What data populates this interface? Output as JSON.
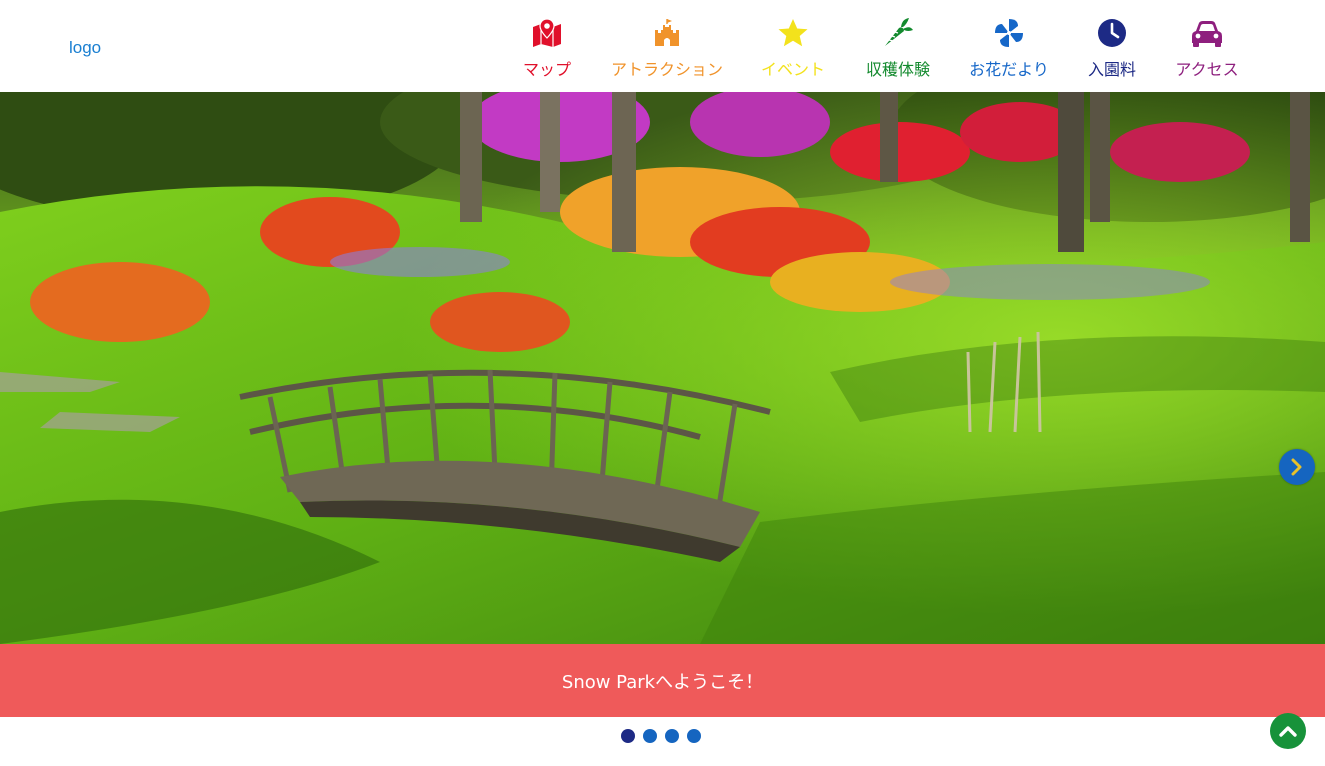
{
  "header": {
    "logo_text": "logo",
    "nav": [
      {
        "label": "マップ",
        "icon": "map-marker-icon",
        "color": "#e0102b"
      },
      {
        "label": "アトラクション",
        "icon": "castle-icon",
        "color": "#f0932b"
      },
      {
        "label": "イベント",
        "icon": "star-icon",
        "color": "#f3e21c"
      },
      {
        "label": "収穫体験",
        "icon": "carrot-icon",
        "color": "#138a2e"
      },
      {
        "label": "お花だより",
        "icon": "pinwheel-icon",
        "color": "#1667c8"
      },
      {
        "label": "入園料",
        "icon": "clock-icon",
        "color": "#1d2a85"
      },
      {
        "label": "アクセス",
        "icon": "car-icon",
        "color": "#8e1f7e"
      }
    ]
  },
  "hero": {
    "image": "garden-bridge-photo",
    "next_icon": "chevron-right-icon"
  },
  "welcome": {
    "text": "Snow Parkへようこそ！",
    "background": "#ef5a5a"
  },
  "carousel": {
    "dots": [
      {
        "color": "#1d2a85",
        "active": true
      },
      {
        "color": "#1565c0",
        "active": false
      },
      {
        "color": "#1565c0",
        "active": false
      },
      {
        "color": "#1565c0",
        "active": false
      }
    ]
  },
  "back_to_top": {
    "icon": "chevron-up-icon",
    "color": "#17923a"
  }
}
